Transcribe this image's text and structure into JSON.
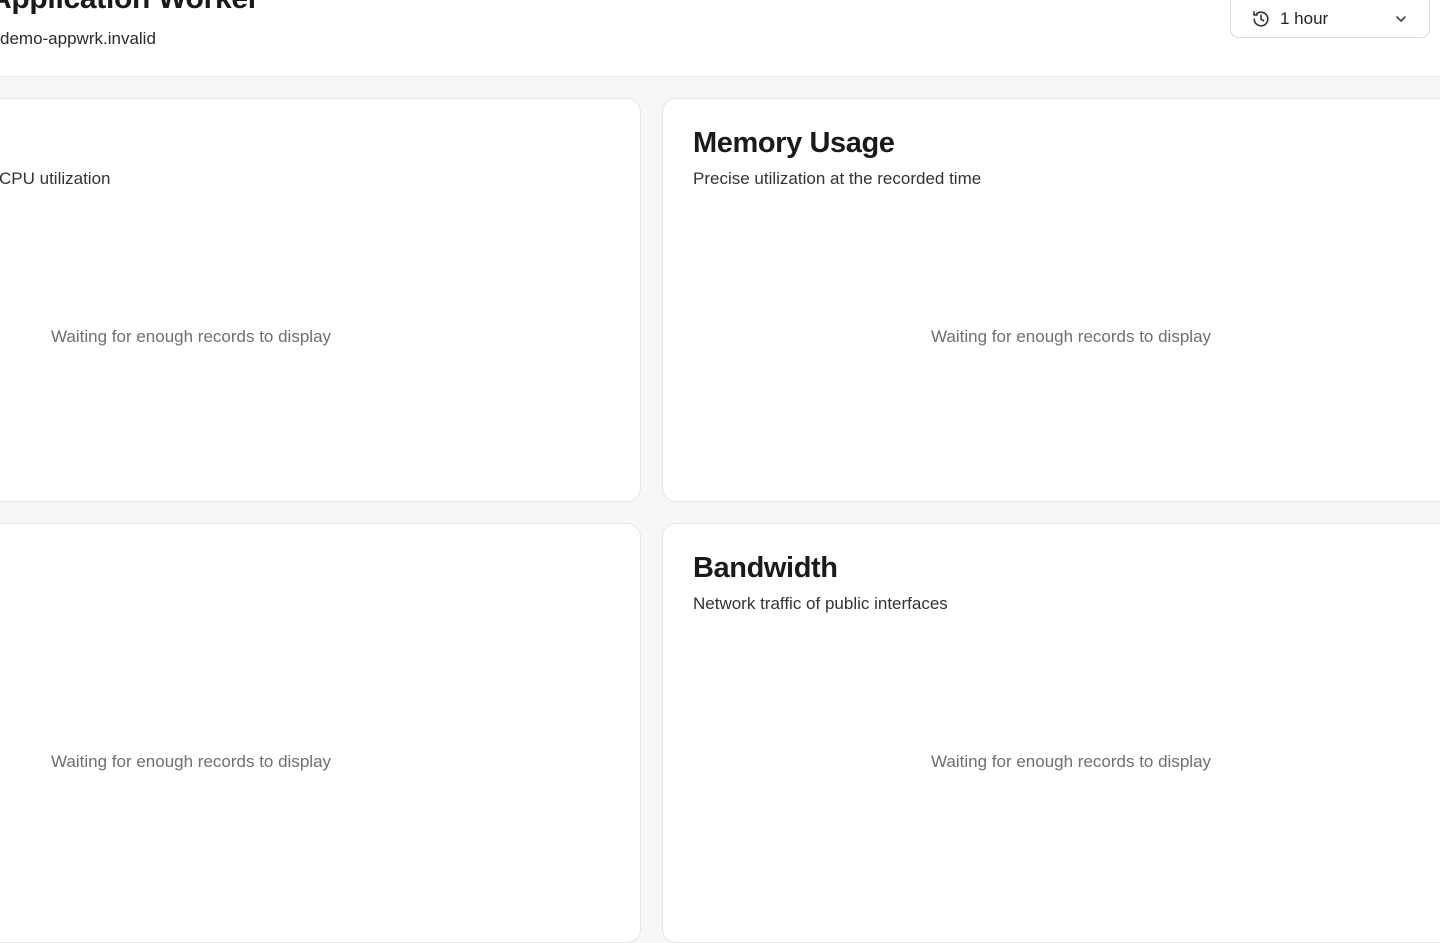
{
  "header": {
    "title": "Application Worker",
    "subtitle": "demo-appwrk.invalid",
    "range_select": {
      "selected": "1 hour",
      "icon": "history-icon",
      "chevron": "chevron-down-icon"
    }
  },
  "cards": [
    {
      "title": "",
      "description": "CPU utilization",
      "empty_message": "Waiting for enough records to display"
    },
    {
      "title": "Memory Usage",
      "description": "Precise utilization at the recorded time",
      "empty_message": "Waiting for enough records to display"
    },
    {
      "title": "",
      "description": "",
      "empty_message": "Waiting for enough records to display"
    },
    {
      "title": "Bandwidth",
      "description": "Network traffic of public interfaces",
      "empty_message": "Waiting for enough records to display"
    }
  ],
  "colors": {
    "background": "#f7f7f7",
    "card": "#ffffff",
    "border": "#e6e6e6",
    "muted_text": "#6f6f6f"
  }
}
